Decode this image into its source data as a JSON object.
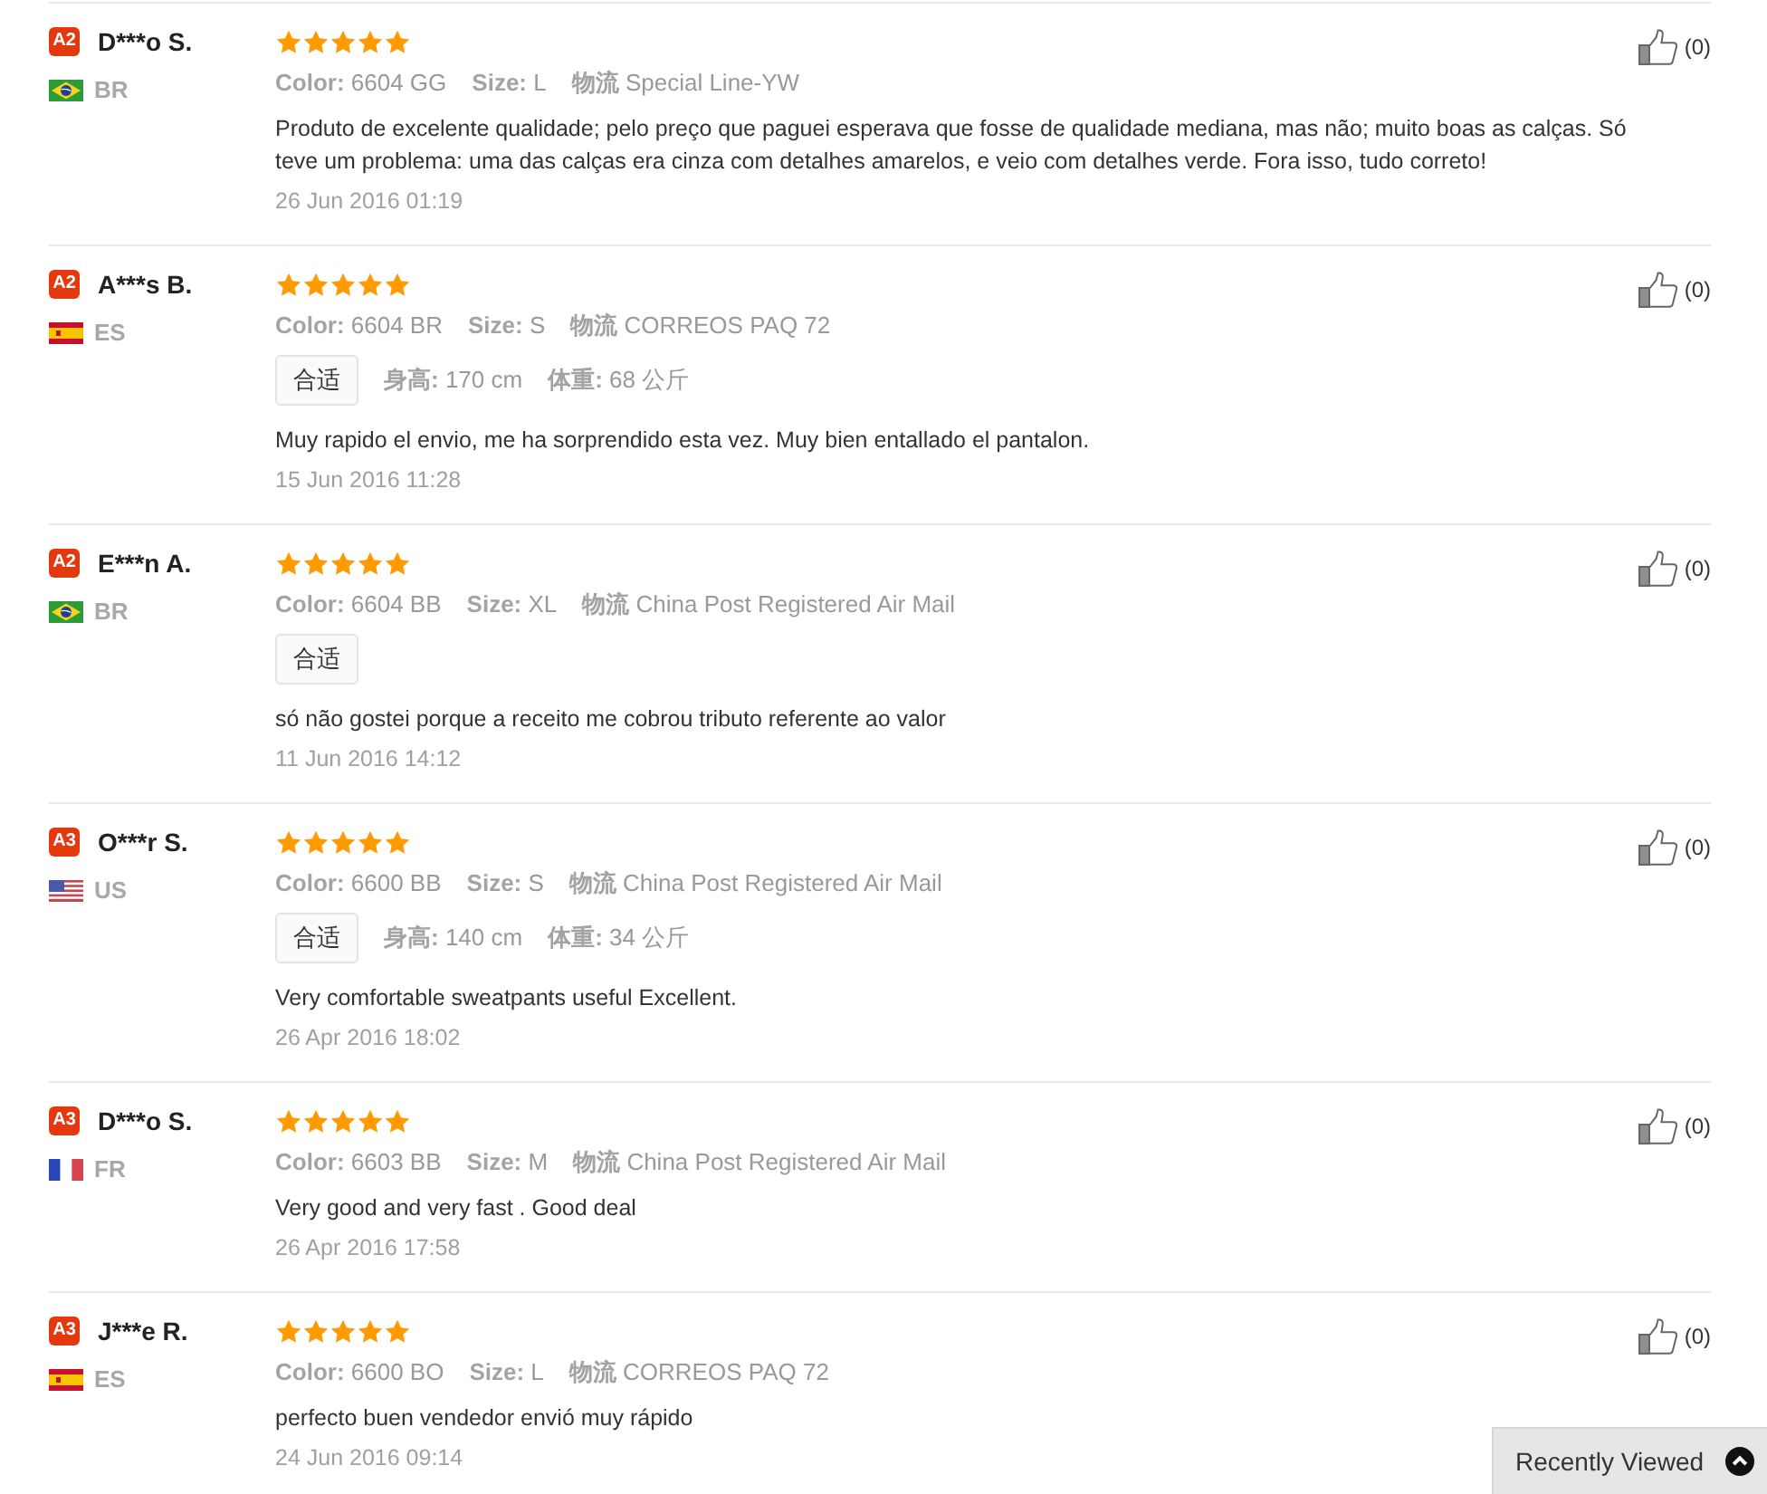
{
  "reviews": [
    {
      "reviewer": {
        "badge": "A2",
        "name": "D***o S.",
        "country": {
          "kind": "brazil",
          "code": "BR"
        }
      },
      "stars": 5,
      "attributes": [
        {
          "label": "Color:",
          "value": "6604 GG"
        },
        {
          "label": "Size:",
          "value": "L"
        },
        {
          "label": "物流",
          "value": "Special Line-YW"
        }
      ],
      "comment": "Produto de excelente qualidade; pelo preço que paguei esperava que fosse de qualidade mediana, mas não; muito boas as calças. Só teve um problema: uma das calças era cinza com detalhes amarelos, e veio com detalhes verde. Fora isso, tudo correto!",
      "date": "26 Jun 2016 01:19",
      "helpful": {
        "count": "(0)"
      }
    },
    {
      "reviewer": {
        "badge": "A2",
        "name": "A***s B.",
        "country": {
          "kind": "spain",
          "code": "ES"
        }
      },
      "stars": 5,
      "attributes": [
        {
          "label": "Color:",
          "value": "6604 BR"
        },
        {
          "label": "Size:",
          "value": "S"
        },
        {
          "label": "物流",
          "value": "CORREOS PAQ 72"
        }
      ],
      "fit": {
        "tag": "合适",
        "measurements": [
          {
            "label": "身高:",
            "value": "170 cm"
          },
          {
            "label": "体重:",
            "value": "68 公斤"
          }
        ]
      },
      "comment": "Muy rapido el envio, me ha sorprendido esta vez. Muy bien entallado el pantalon.",
      "date": "15 Jun 2016 11:28",
      "helpful": {
        "count": "(0)"
      }
    },
    {
      "reviewer": {
        "badge": "A2",
        "name": "E***n A.",
        "country": {
          "kind": "brazil",
          "code": "BR"
        }
      },
      "stars": 5,
      "attributes": [
        {
          "label": "Color:",
          "value": "6604 BB"
        },
        {
          "label": "Size:",
          "value": "XL"
        },
        {
          "label": "物流",
          "value": "China Post Registered Air Mail"
        }
      ],
      "fit": {
        "tag": "合适"
      },
      "comment": "só não gostei porque a receito me cobrou tributo referente ao valor",
      "date": "11 Jun 2016 14:12",
      "helpful": {
        "count": "(0)"
      }
    },
    {
      "reviewer": {
        "badge": "A3",
        "name": "O***r S.",
        "country": {
          "kind": "usa",
          "code": "US"
        }
      },
      "stars": 5,
      "attributes": [
        {
          "label": "Color:",
          "value": "6600 BB"
        },
        {
          "label": "Size:",
          "value": "S"
        },
        {
          "label": "物流",
          "value": "China Post Registered Air Mail"
        }
      ],
      "fit": {
        "tag": "合适",
        "measurements": [
          {
            "label": "身高:",
            "value": "140 cm"
          },
          {
            "label": "体重:",
            "value": "34 公斤"
          }
        ]
      },
      "comment": "Very comfortable sweatpants useful Excellent.",
      "date": "26 Apr 2016 18:02",
      "helpful": {
        "count": "(0)"
      }
    },
    {
      "reviewer": {
        "badge": "A3",
        "name": "D***o S.",
        "country": {
          "kind": "france",
          "code": "FR"
        }
      },
      "stars": 5,
      "attributes": [
        {
          "label": "Color:",
          "value": "6603 BB"
        },
        {
          "label": "Size:",
          "value": "M"
        },
        {
          "label": "物流",
          "value": "China Post Registered Air Mail"
        }
      ],
      "comment": "Very good and very fast . Good deal",
      "date": "26 Apr 2016 17:58",
      "helpful": {
        "count": "(0)"
      }
    },
    {
      "reviewer": {
        "badge": "A3",
        "name": "J***e R.",
        "country": {
          "kind": "spain",
          "code": "ES"
        }
      },
      "stars": 5,
      "attributes": [
        {
          "label": "Color:",
          "value": "6600 BO"
        },
        {
          "label": "Size:",
          "value": "L"
        },
        {
          "label": "物流",
          "value": "CORREOS PAQ 72"
        }
      ],
      "comment": "perfecto buen vendedor envió muy rápido",
      "date": "24 Jun 2016 09:14",
      "helpful": {
        "count": "(0)"
      }
    }
  ],
  "recently_viewed": {
    "label": "Recently Viewed"
  }
}
